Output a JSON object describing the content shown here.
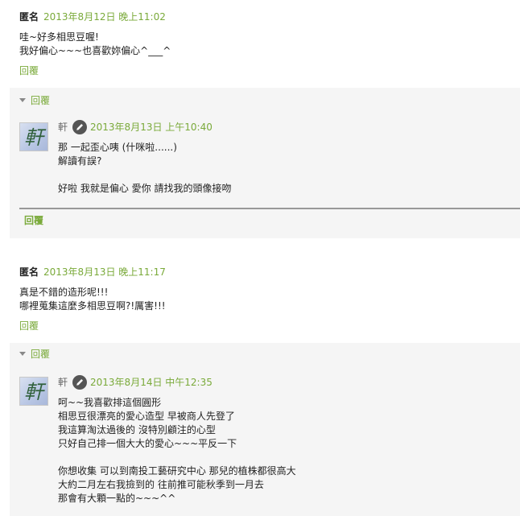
{
  "comments": [
    {
      "author": "匿名",
      "timestamp": "2013年8月12日 晚上11:02",
      "body": [
        "哇~好多相思豆喔!",
        "我好偏心~~~也喜歡妳偏心^___^"
      ],
      "reply_label": "回覆",
      "replies_toggle": "回覆",
      "reply": {
        "avatar_char": "軒",
        "author": "軒",
        "timestamp": "2013年8月13日 上午10:40",
        "body": [
          "那 一起歪心咦 (什咪啦......)",
          "解讀有誤?",
          "",
          "好啦 我就是偏心 愛你 請找我的頭像接吻"
        ],
        "reply_label": "回覆"
      }
    },
    {
      "author": "匿名",
      "timestamp": "2013年8月13日 晚上11:17",
      "body": [
        "真是不錯的造形呢!!!",
        "哪裡蒐集這麼多相思豆啊?!厲害!!!"
      ],
      "reply_label": "回覆",
      "replies_toggle": "回覆",
      "reply": {
        "avatar_char": "軒",
        "author": "軒",
        "timestamp": "2013年8月14日 中午12:35",
        "body": [
          "呵~~我喜歡排這個圓形",
          "相思豆很漂亮的愛心造型 早被商人先登了",
          "我這算淘汰過後的 沒特別顧注的心型",
          "只好自己排一個大大的愛心~~~平反一下",
          "",
          "你想收集 可以到南投工藝研究中心 那兒的植株都很高大",
          "大約二月左右我撿到的 往前推可能秋季到一月去",
          "那會有大顆一點的~~~^^"
        ]
      }
    }
  ],
  "colors": {
    "link": "#7aaa3a",
    "reply_bg": "#f5f5f5",
    "divider": "#999999"
  },
  "icons": [
    "caret-down-icon",
    "pencil-icon"
  ]
}
